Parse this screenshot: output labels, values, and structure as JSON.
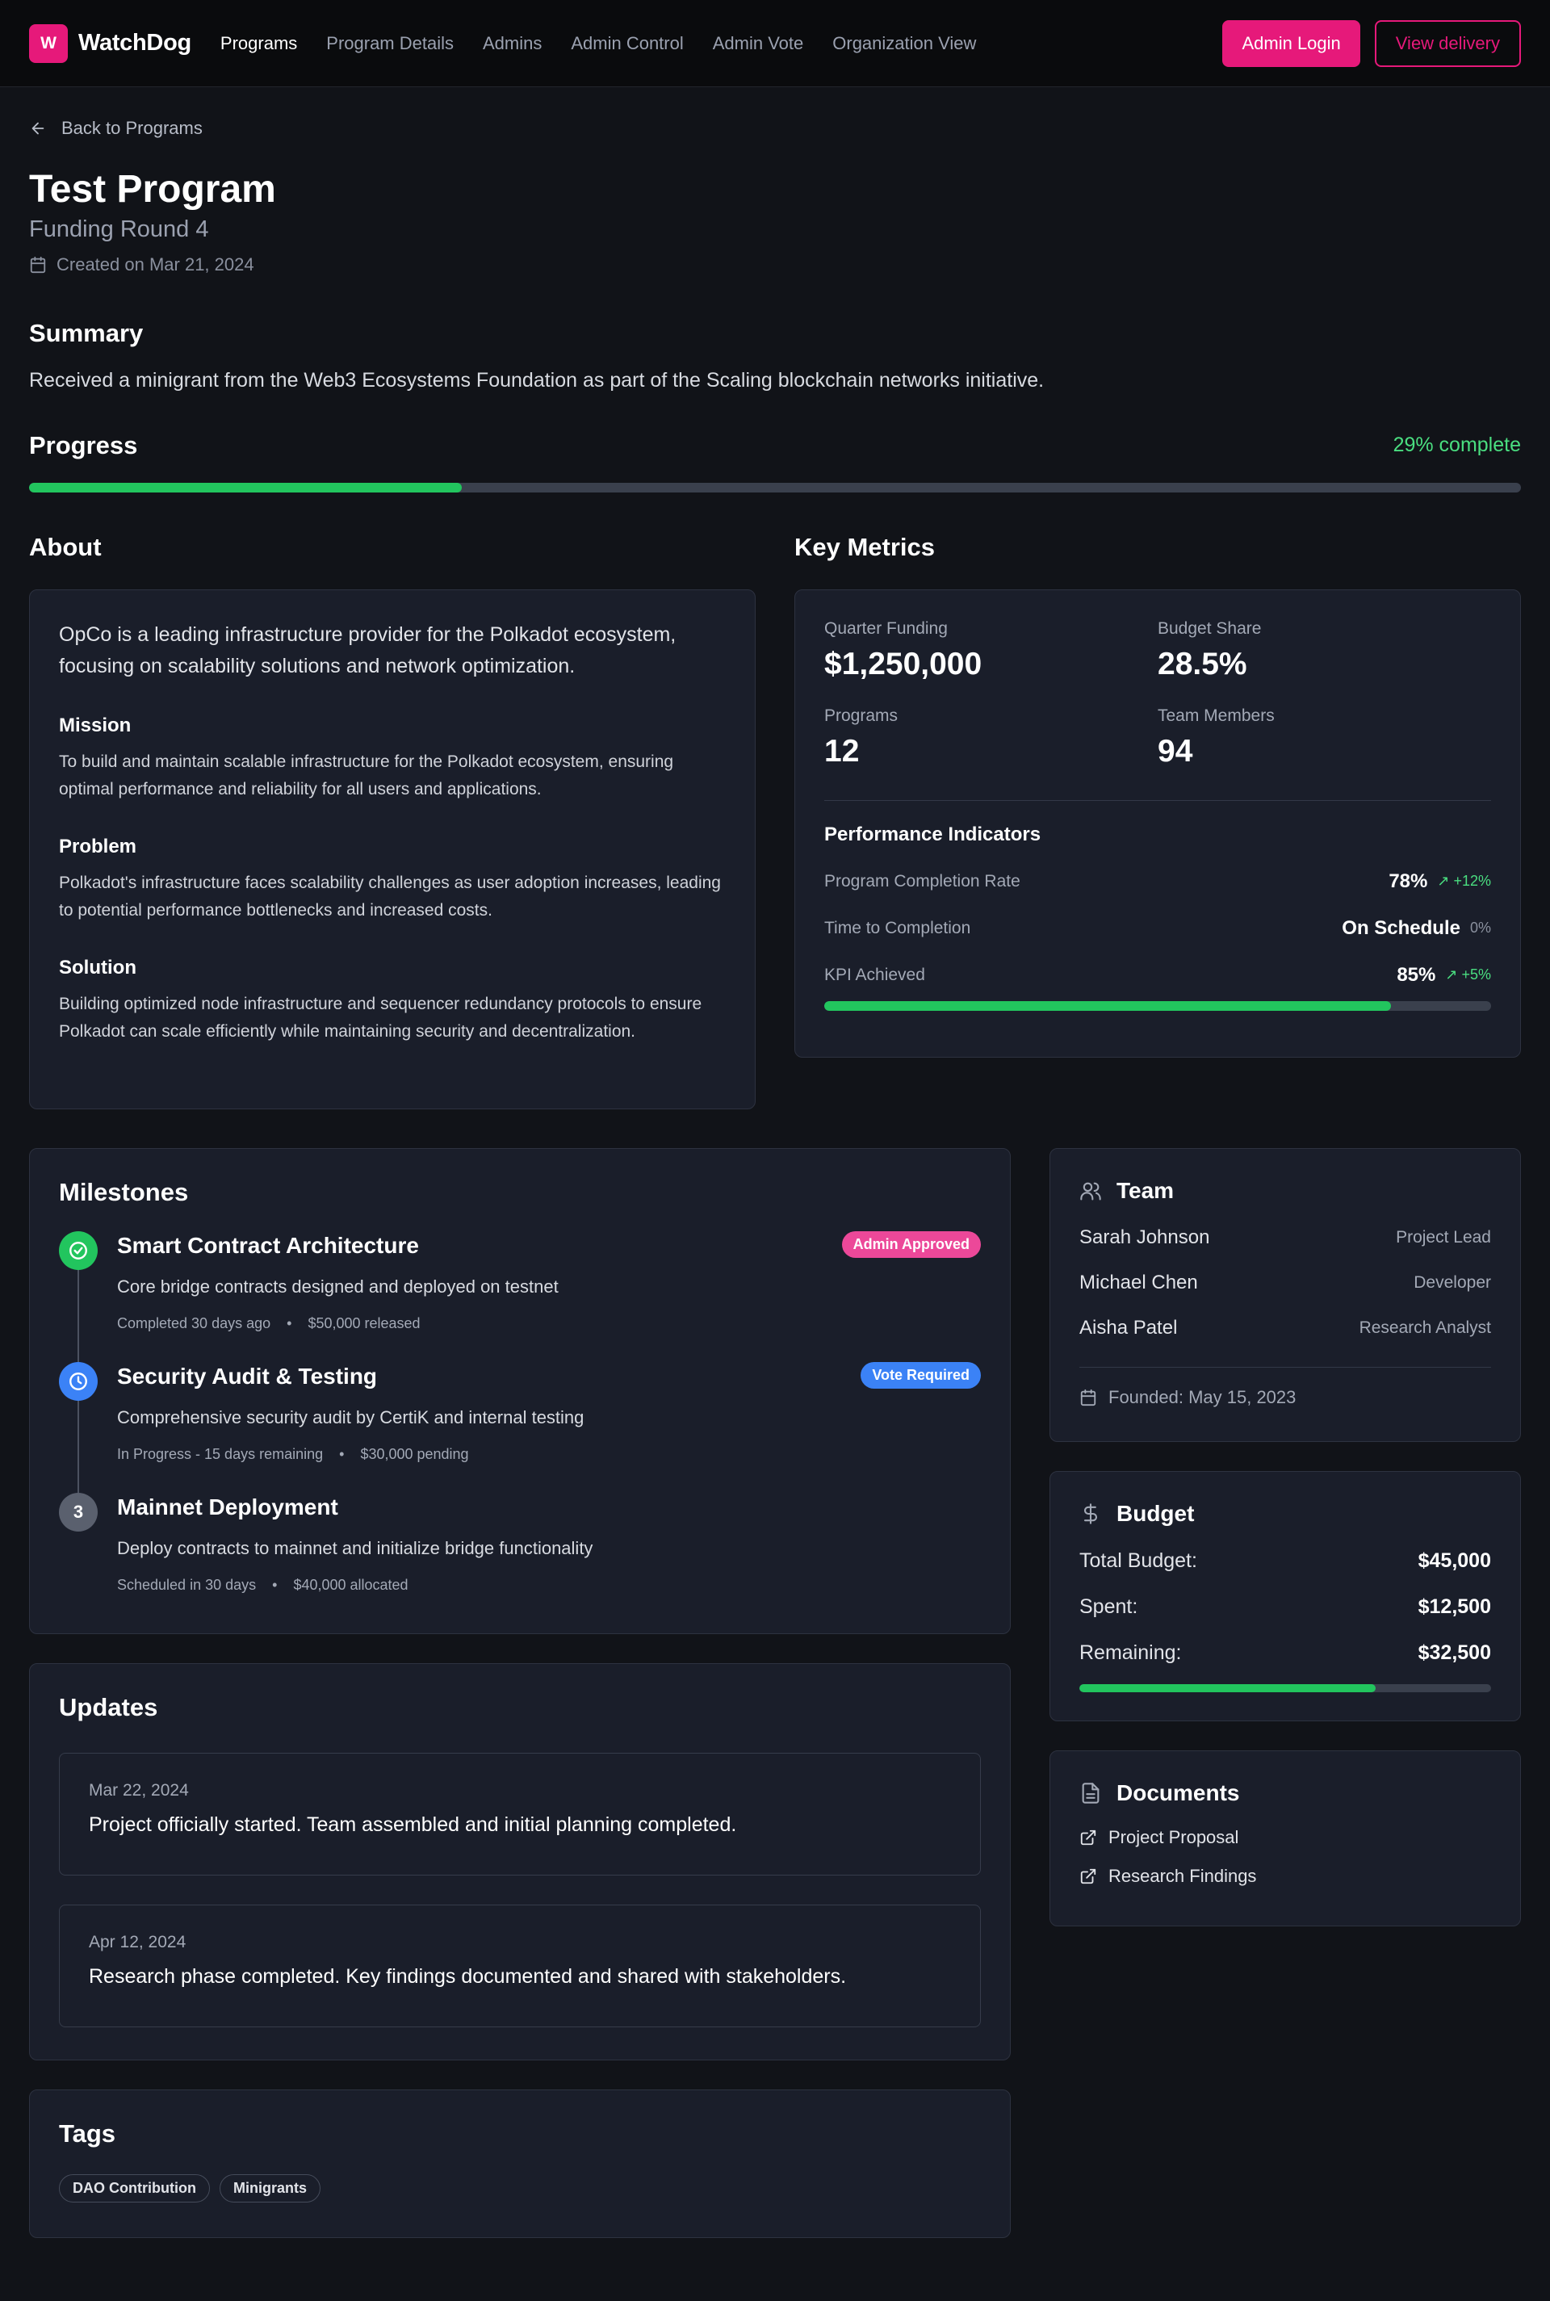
{
  "nav": {
    "logo_letter": "W",
    "brand": "WatchDog",
    "links": [
      "Programs",
      "Program Details",
      "Admins",
      "Admin Control",
      "Admin Vote",
      "Organization View"
    ],
    "admin_login": "Admin Login",
    "view_delivery": "View delivery"
  },
  "back_label": "Back to Programs",
  "program": {
    "title": "Test Program",
    "subtitle": "Funding Round 4",
    "created": "Created on Mar 21, 2024"
  },
  "summary": {
    "heading": "Summary",
    "text": "Received a minigrant from the Web3 Ecosystems Foundation as part of the Scaling blockchain networks initiative."
  },
  "progress": {
    "heading": "Progress",
    "label": "29% complete",
    "value": 0.29
  },
  "about": {
    "heading": "About",
    "intro": "OpCo is a leading infrastructure provider for the Polkadot ecosystem, focusing on scalability solutions and network optimization.",
    "mission_h": "Mission",
    "mission": "To build and maintain scalable infrastructure for the Polkadot ecosystem, ensuring optimal performance and reliability for all users and applications.",
    "problem_h": "Problem",
    "problem": "Polkadot's infrastructure faces scalability challenges as user adoption increases, leading to potential performance bottlenecks and increased costs.",
    "solution_h": "Solution",
    "solution": "Building optimized node infrastructure and sequencer redundancy protocols to ensure Polkadot can scale efficiently while maintaining security and decentralization."
  },
  "metrics": {
    "heading": "Key Metrics",
    "items": [
      {
        "label": "Quarter Funding",
        "value": "$1,250,000"
      },
      {
        "label": "Budget Share",
        "value": "28.5%"
      },
      {
        "label": "Programs",
        "value": "12"
      },
      {
        "label": "Team Members",
        "value": "94"
      }
    ],
    "perf_heading": "Performance Indicators",
    "perf": [
      {
        "label": "Program Completion Rate",
        "value": "78%",
        "delta": "↗ +12%"
      },
      {
        "label": "Time to Completion",
        "value": "On Schedule",
        "delta": "0%"
      },
      {
        "label": "KPI Achieved",
        "value": "85%",
        "delta": "↗ +5%"
      }
    ],
    "kpi_progress": 0.85
  },
  "milestones": {
    "heading": "Milestones",
    "items": [
      {
        "num": "",
        "title": "Smart Contract Architecture",
        "desc": "Core bridge contracts designed and deployed on testnet",
        "status": "Completed 30 days ago",
        "amount": "$50,000 released",
        "badge": "Admin Approved"
      },
      {
        "num": "",
        "title": "Security Audit & Testing",
        "desc": "Comprehensive security audit by CertiK and internal testing",
        "status": "In Progress - 15 days remaining",
        "amount": "$30,000 pending",
        "badge": "Vote Required"
      },
      {
        "num": "3",
        "title": "Mainnet Deployment",
        "desc": "Deploy contracts to mainnet and initialize bridge functionality",
        "status": "Scheduled in 30 days",
        "amount": "$40,000 allocated",
        "badge": ""
      }
    ]
  },
  "updates": {
    "heading": "Updates",
    "items": [
      {
        "date": "Mar 22, 2024",
        "text": "Project officially started. Team assembled and initial planning completed."
      },
      {
        "date": "Apr 12, 2024",
        "text": "Research phase completed. Key findings documented and shared with stakeholders."
      }
    ]
  },
  "tags": {
    "heading": "Tags",
    "items": [
      "DAO Contribution",
      "Minigrants"
    ]
  },
  "team": {
    "heading": "Team",
    "members": [
      {
        "name": "Sarah Johnson",
        "role": "Project Lead"
      },
      {
        "name": "Michael Chen",
        "role": "Developer"
      },
      {
        "name": "Aisha Patel",
        "role": "Research Analyst"
      }
    ],
    "founded": "Founded: May 15, 2023"
  },
  "budget": {
    "heading": "Budget",
    "rows": [
      {
        "label": "Total Budget:",
        "value": "$45,000"
      },
      {
        "label": "Spent:",
        "value": "$12,500"
      },
      {
        "label": "Remaining:",
        "value": "$32,500"
      }
    ],
    "bar_value": 0.72
  },
  "documents": {
    "heading": "Documents",
    "items": [
      "Project Proposal",
      "Research Findings"
    ]
  },
  "colors": {
    "accent": "#e6197a",
    "success": "#22c55e",
    "info": "#3b82f6",
    "badge_approved": "#ec4899"
  }
}
